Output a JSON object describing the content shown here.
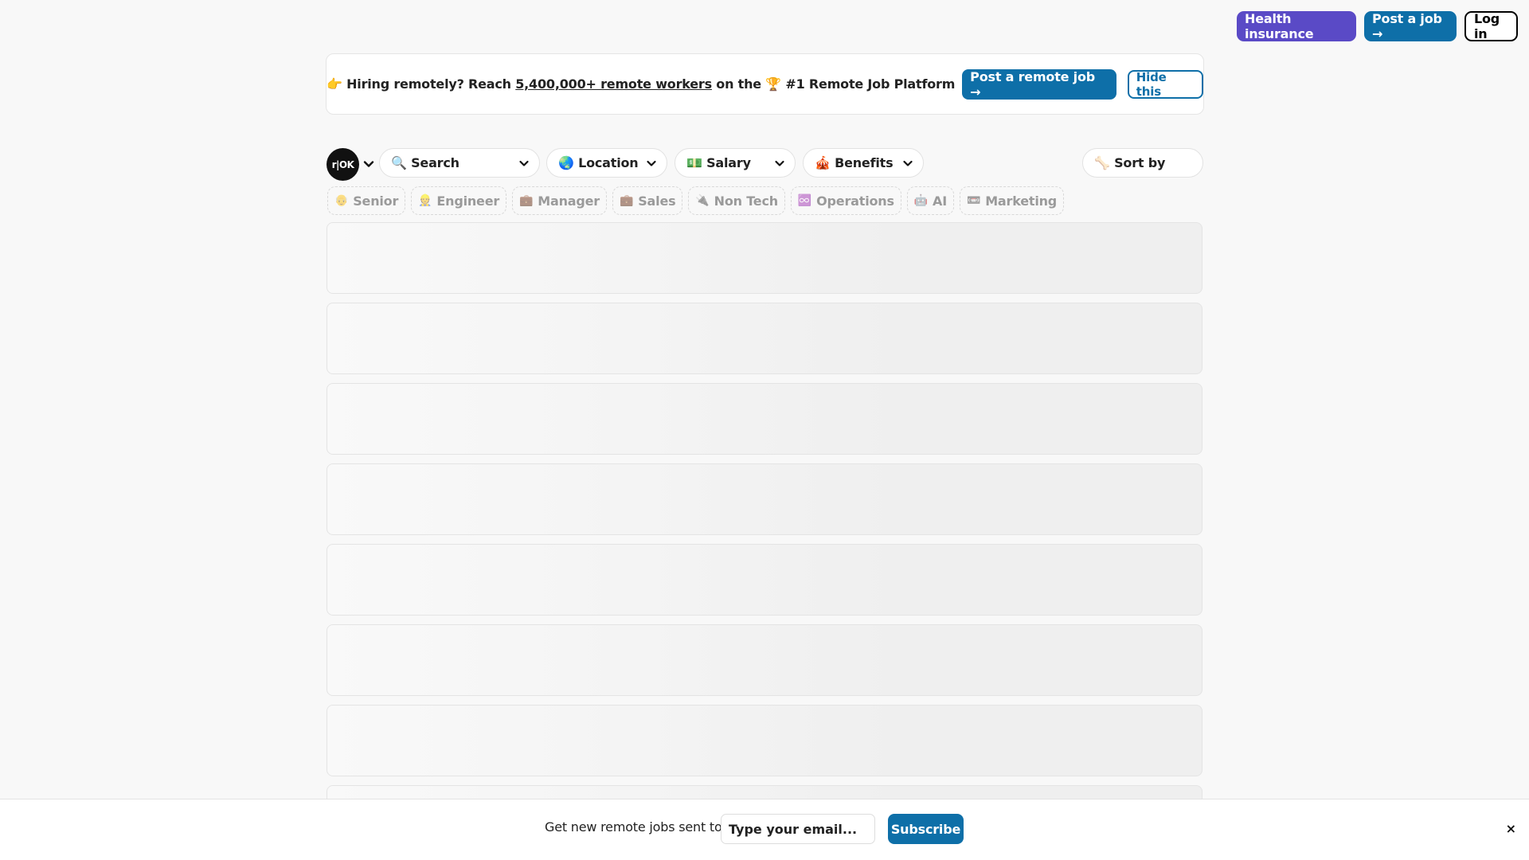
{
  "nav": {
    "health_label": "Health insurance",
    "post_job_label": "Post a job →",
    "login_label": "Log in"
  },
  "banner": {
    "prefix": "👉 Hiring remotely? Reach ",
    "link_text": "5,400,000+ remote workers",
    "suffix": " on the 🏆 #1 Remote Job Platform",
    "post_button": "Post a remote job →",
    "hide_button": "Hide this"
  },
  "filters": {
    "logo_text": "r|OK",
    "search": "🔍 Search",
    "location": "🌏 Location",
    "salary": "💵 Salary",
    "benefits": "🎪 Benefits",
    "sort": "🦴 Sort by"
  },
  "tags": [
    {
      "icon": "👴",
      "label": "Senior"
    },
    {
      "icon": "👷",
      "label": "Engineer"
    },
    {
      "icon": "💼",
      "label": "Manager"
    },
    {
      "icon": "💼",
      "label": "Sales"
    },
    {
      "icon": "🔌",
      "label": "Non Tech"
    },
    {
      "icon": "♾️",
      "label": "Operations"
    },
    {
      "icon": "🤖",
      "label": "AI"
    },
    {
      "icon": "📼",
      "label": "Marketing"
    }
  ],
  "subscribe": {
    "text": "Get new remote jobs sent to",
    "placeholder": "Type your email...",
    "button": "Subscribe",
    "close": "×"
  },
  "colors": {
    "brand_blue": "#0e6fa8",
    "health_purple": "#5a4ac6",
    "background": "#f8f8f8"
  }
}
